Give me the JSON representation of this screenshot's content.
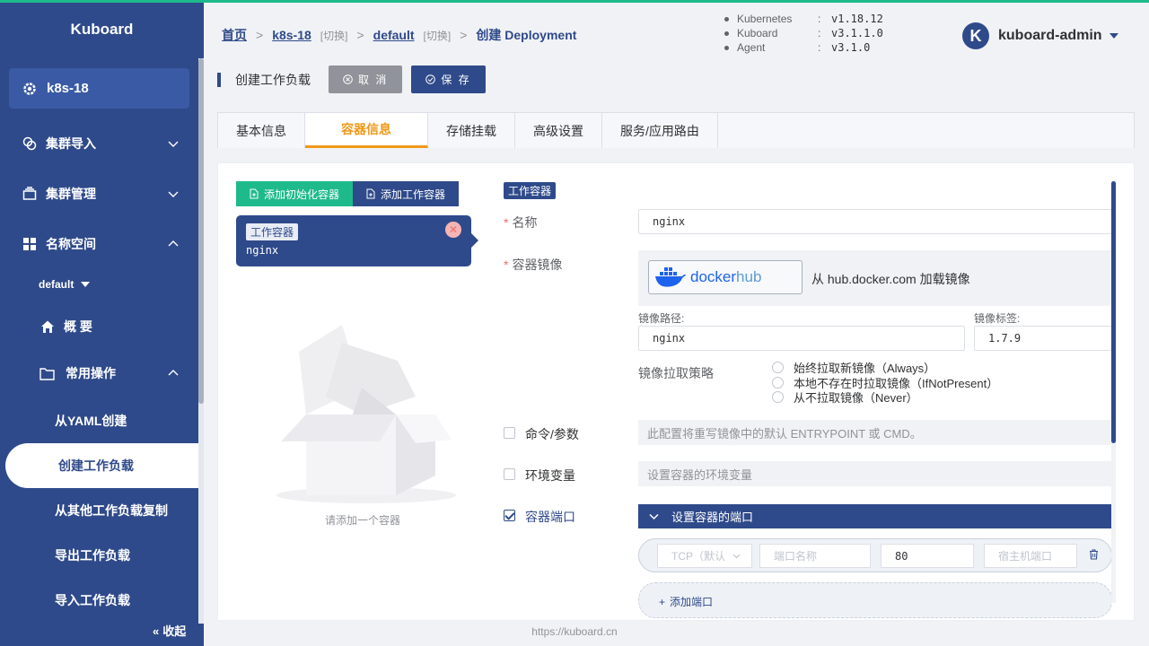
{
  "sidebar": {
    "brand": "Kuboard",
    "cluster": "k8s-18",
    "menu": [
      {
        "label": "集群导入"
      },
      {
        "label": "集群管理"
      },
      {
        "label": "名称空间"
      }
    ],
    "namespace": "default",
    "overview": "概 要",
    "common_ops": "常用操作",
    "sub_items": [
      "从YAML创建",
      "创建工作负载",
      "从其他工作负载复制",
      "导出工作负载",
      "导入工作负载"
    ],
    "collapse": "收起"
  },
  "header": {
    "breadcrumb": {
      "home": "首页",
      "cluster": "k8s-18",
      "switch1": "[切换]",
      "namespace": "default",
      "switch2": "[切换]",
      "current": "创建 Deployment"
    },
    "versions": [
      {
        "name": "Kubernetes",
        "value": "v1.18.12"
      },
      {
        "name": "Kuboard",
        "value": "v3.1.1.0"
      },
      {
        "name": "Agent",
        "value": "v3.1.0"
      }
    ],
    "user": {
      "initial": "K",
      "name": "kuboard-admin"
    }
  },
  "actionbar": {
    "title": "创建工作负载",
    "cancel": "取 消",
    "save": "保 存"
  },
  "tabs": [
    "基本信息",
    "容器信息",
    "存储挂载",
    "高级设置",
    "服务/应用路由"
  ],
  "containers": {
    "add_init": "添加初始化容器",
    "add_work": "添加工作容器",
    "card_tag": "工作容器",
    "card_name": "nginx",
    "empty_tip": "请添加一个容器"
  },
  "form": {
    "section_tag": "工作容器",
    "name_label": "名称",
    "name_value": "nginx",
    "image_label": "容器镜像",
    "docker_logo": {
      "a": "docker",
      "b": "hub"
    },
    "docker_text": "从 hub.docker.com 加载镜像",
    "image_path_label": "镜像路径:",
    "image_path": "nginx",
    "image_tag_label": "镜像标签:",
    "image_tag": "1.7.9",
    "pull_policy_label": "镜像拉取策略",
    "pull_options": [
      "始终拉取新镜像（Always）",
      "本地不存在时拉取镜像（IfNotPresent）",
      "从不拉取镜像（Never）"
    ],
    "cmd_label": "命令/参数",
    "cmd_hint": "此配置将重写镜像中的默认 ENTRYPOINT 或 CMD。",
    "env_label": "环境变量",
    "env_hint": "设置容器的环境变量",
    "port_label": "容器端口",
    "port_head": "设置容器的端口",
    "port_row": {
      "protocol_placeholder": "TCP（默认",
      "name_placeholder": "端口名称",
      "port_value": "80",
      "host_placeholder": "宿主机端口"
    },
    "add_port": "添加端口"
  },
  "footer": "https://kuboard.cn",
  "colors": {
    "primary": "#2f4a8a",
    "accent": "#f09819",
    "success": "#1fba8c",
    "danger": "#f56c6c"
  }
}
